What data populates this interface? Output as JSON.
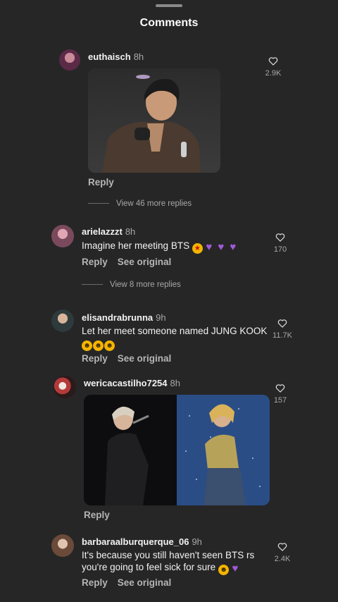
{
  "header": {
    "title": "Comments"
  },
  "actions": {
    "reply": "Reply",
    "see_original": "See original"
  },
  "comments": [
    {
      "username": "euthaisch",
      "time": "8h",
      "text": "",
      "likes": "2.9K",
      "view_more": "View 46 more replies"
    },
    {
      "username": "arielazzzt",
      "time": "8h",
      "text": "Imagine her meeting BTS",
      "likes": "170",
      "view_more": "View 8 more replies"
    },
    {
      "username": "elisandrabrunna",
      "time": "9h",
      "text": "Let her meet someone named JUNG KOOK",
      "likes": "11.7K"
    },
    {
      "username": "wericacastilho7254",
      "time": "8h",
      "text": "",
      "likes": "157"
    },
    {
      "username": "barbaraalburquerque_06",
      "time": "9h",
      "text_line1": "It's because you still haven't seen BTS rs",
      "text_line2": "you're going to feel sick for sure",
      "likes": "2.4K"
    }
  ],
  "colors": {
    "background": "#262626",
    "secondary_text": "#a8a8a8",
    "emoji_heart": "#a05bd8"
  },
  "icons": {
    "like": "heart-outline-icon"
  }
}
